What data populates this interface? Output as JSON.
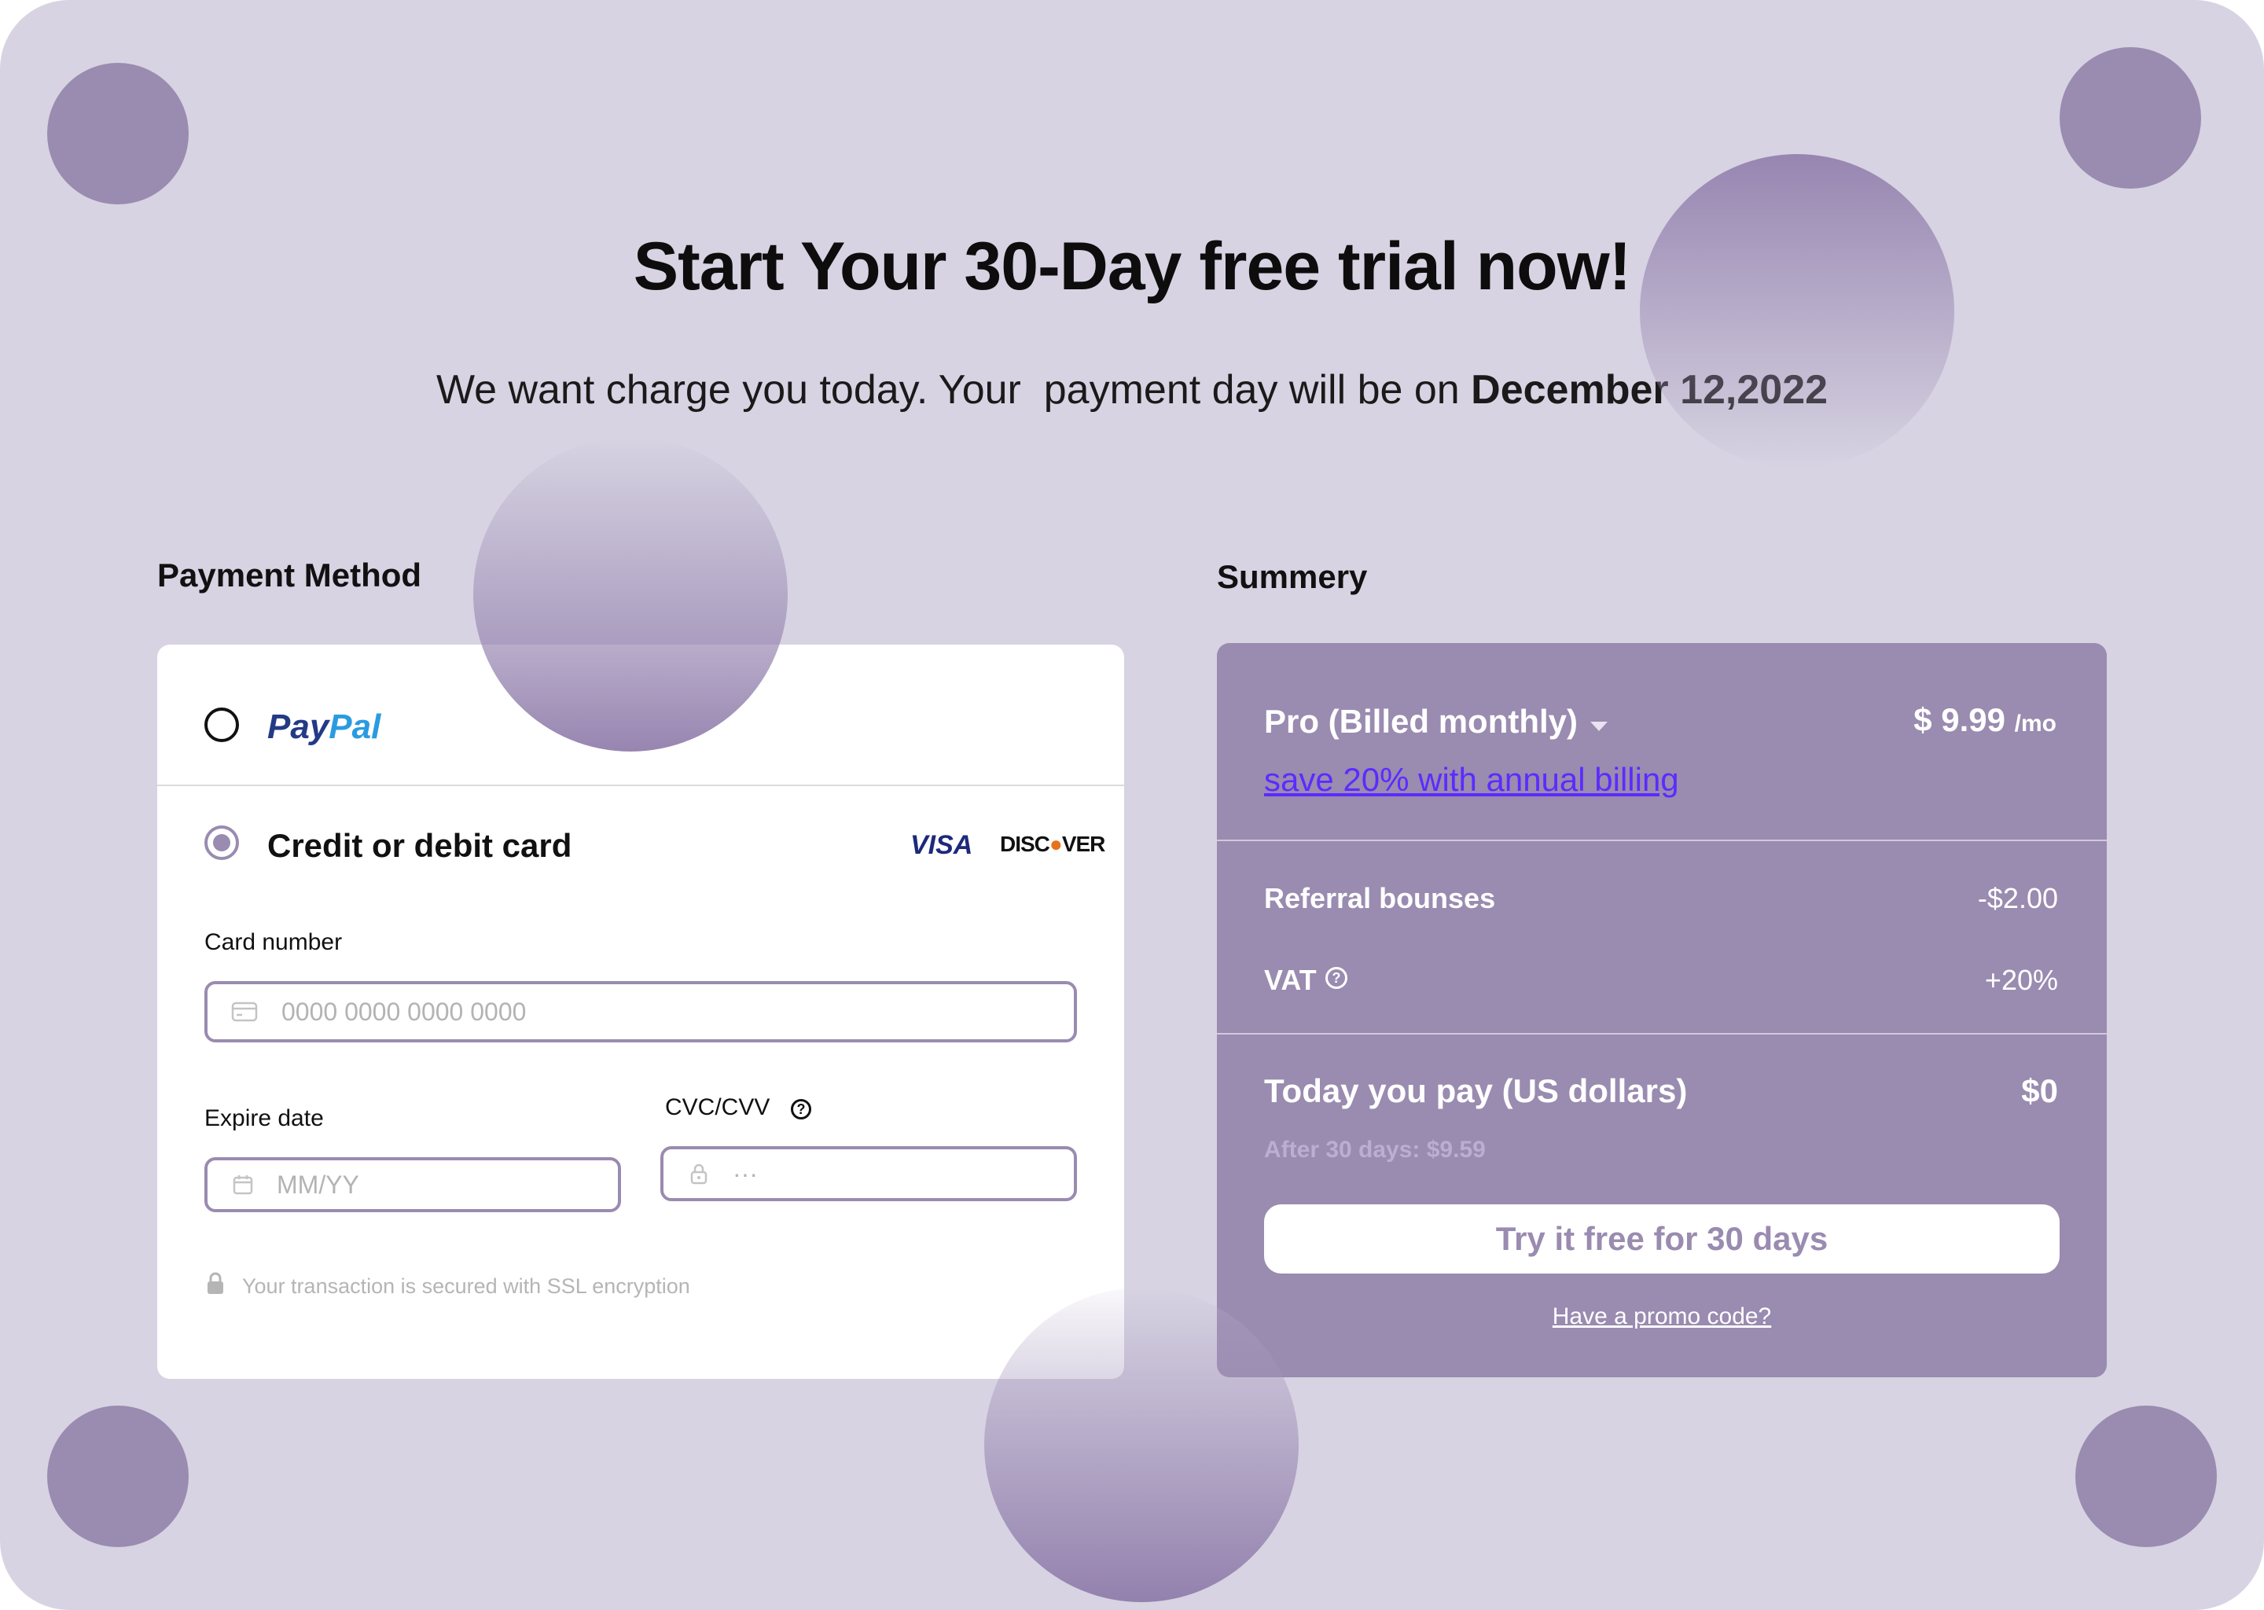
{
  "header": {
    "title": "Start Your 30-Day free trial now!",
    "subtitle_prefix": "We want charge you today. Your  payment day will be on ",
    "subtitle_date": "December 12,2022"
  },
  "payment": {
    "section_title": "Payment Method",
    "paypal": {
      "part1": "Pay",
      "part2": "Pal",
      "selected": false
    },
    "card_option": {
      "label": "Credit or debit card",
      "selected": true
    },
    "brands": [
      "VISA",
      "DISCOVER"
    ],
    "card_number": {
      "label": "Card number",
      "placeholder": "0000 0000 0000 0000",
      "value": ""
    },
    "expire": {
      "label": "Expire date",
      "placeholder": "MM/YY",
      "value": ""
    },
    "cvc": {
      "label": "CVC/CVV",
      "placeholder": "···",
      "value": ""
    },
    "secure_note": "Your transaction is secured with SSL encryption",
    "icons": [
      "card-icon",
      "calendar-icon",
      "lock-icon",
      "help-icon"
    ]
  },
  "summary": {
    "section_title": "Summery",
    "plan": "Pro (Billed monthly)",
    "price": "$ 9.99",
    "per": "/mo",
    "annual_link": "save 20% with annual billing",
    "referral_label": "Referral bounses",
    "referral_value": "-$2.00",
    "vat_label": "VAT",
    "vat_value": "+20%",
    "today_label": "Today you pay (US dollars)",
    "today_value": "$0",
    "after_note": "After 30 days: $9.59",
    "cta": "Try it free for 30 days",
    "promo": "Have a promo code?"
  },
  "colors": {
    "background": "#d7d3e2",
    "accent": "#9a8bb0",
    "link": "#5c2bff",
    "paypal_dark": "#233a85",
    "paypal_light": "#2b9be0"
  }
}
